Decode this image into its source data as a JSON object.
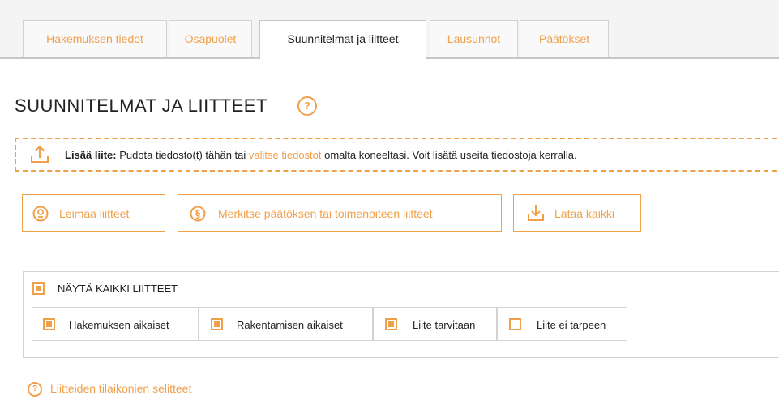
{
  "tabs": [
    {
      "label": "Hakemuksen tiedot",
      "active": false
    },
    {
      "label": "Osapuolet",
      "active": false
    },
    {
      "label": "Suunnitelmat ja liitteet",
      "active": true
    },
    {
      "label": "Lausunnot",
      "active": false
    },
    {
      "label": "Päätökset",
      "active": false
    }
  ],
  "page_title": "SUUNNITELMAT JA LIITTEET",
  "help_glyph": "?",
  "dropzone": {
    "bold_label": "Lisää liite:",
    "text_before": " Pudota tiedosto(t) tähän tai ",
    "link": "valitse tiedostot",
    "text_after": " omalta koneeltasi. Voit lisätä useita tiedostoja kerralla."
  },
  "actions": {
    "stamp": "Leimaa liitteet",
    "mark": "Merkitse päätöksen tai toimenpiteen liitteet",
    "download": "Lataa kaikki"
  },
  "filters": {
    "show_all": "NÄYTÄ KAIKKI LIITTEET",
    "items": [
      {
        "label": "Hakemuksen aikaiset",
        "checked": true
      },
      {
        "label": "Rakentamisen aikaiset",
        "checked": true
      },
      {
        "label": "Liite tarvitaan",
        "checked": true
      },
      {
        "label": "Liite ei tarpeen",
        "checked": false
      }
    ]
  },
  "legend_link": "Liitteiden tilaikonien selitteet",
  "colors": {
    "accent": "#f0a04b",
    "border": "#d2d2d2"
  }
}
